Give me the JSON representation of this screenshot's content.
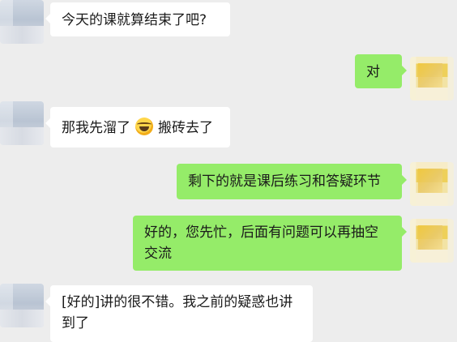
{
  "messages": [
    {
      "side": "in",
      "text": "今天的课就算结束了吧?"
    },
    {
      "side": "out",
      "text": "对"
    },
    {
      "side": "in",
      "text_before": "那我先溜了",
      "emoji": "laugh-cry-emoji",
      "text_after": "搬砖去了"
    },
    {
      "side": "out",
      "text": "剩下的就是课后练习和答疑环节"
    },
    {
      "side": "out",
      "text": "好的，您先忙，后面有问题可以再抽空交流"
    },
    {
      "side": "in",
      "text": "[好的]讲的很不错。我之前的疑惑也讲到了"
    }
  ],
  "colors": {
    "background": "#ededed",
    "incoming": "#ffffff",
    "outgoing": "#95ec69"
  }
}
